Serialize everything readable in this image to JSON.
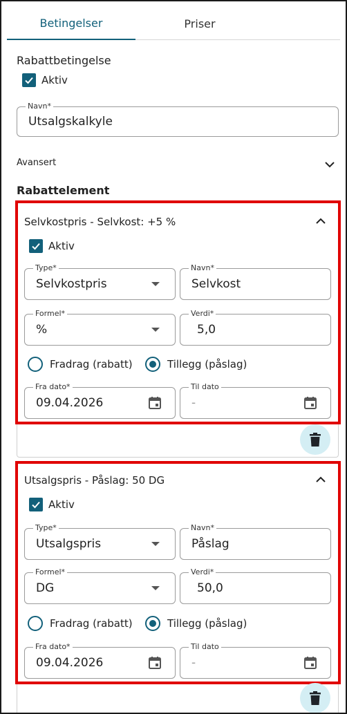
{
  "tabs": [
    {
      "label": "Betingelser"
    },
    {
      "label": "Priser"
    }
  ],
  "condition": {
    "title": "Rabattbetingelse",
    "active_label": "Aktiv",
    "name_label": "Navn*",
    "name_value": "Utsalgskalkyle",
    "advanced_label": "Avansert"
  },
  "elements_title": "Rabattelement",
  "elements": [
    {
      "header": "Selvkostpris - Selvkost: +5 %",
      "active_label": "Aktiv",
      "type_label": "Type*",
      "type_value": "Selvkostpris",
      "name_label": "Navn*",
      "name_value": "Selvkost",
      "formula_label": "Formel*",
      "formula_value": "%",
      "value_label": "Verdi*",
      "value_value": "5,0",
      "radio_deduction": "Fradrag (rabatt)",
      "radio_addition": "Tillegg (påslag)",
      "from_label": "Fra dato*",
      "from_value": "09.04.2026",
      "to_label": "Til dato",
      "to_value": "-"
    },
    {
      "header": "Utsalgspris - Påslag: 50 DG",
      "active_label": "Aktiv",
      "type_label": "Type*",
      "type_value": "Utsalgspris",
      "name_label": "Navn*",
      "name_value": "Påslag",
      "formula_label": "Formel*",
      "formula_value": "DG",
      "value_label": "Verdi*",
      "value_value": "50,0",
      "radio_deduction": "Fradrag (rabatt)",
      "radio_addition": "Tillegg (påslag)",
      "from_label": "Fra dato*",
      "from_value": "09.04.2026",
      "to_label": "Til dato",
      "to_value": "-"
    }
  ],
  "colors": {
    "accent": "#12607a",
    "highlight": "#e00000",
    "delete_bg": "#d4eef4"
  },
  "icons": [
    "check-icon",
    "chevron-down-icon",
    "chevron-up-icon",
    "dropdown-caret-icon",
    "calendar-icon",
    "trash-icon"
  ]
}
